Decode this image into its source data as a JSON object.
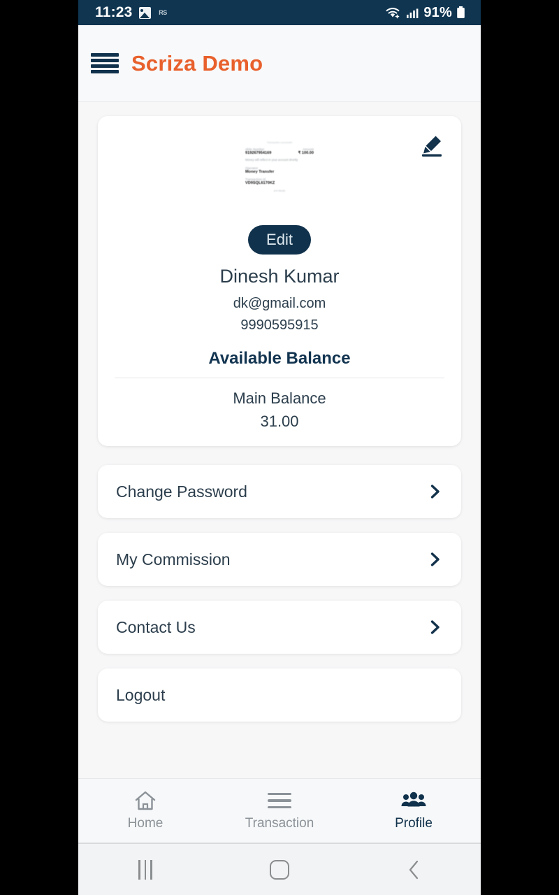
{
  "status_bar": {
    "time": "11:23",
    "battery_percent": "91%",
    "icons": [
      "gallery-icon",
      "app-badge-icon",
      "wifi-icon",
      "cellular-signal-icon",
      "battery-icon"
    ]
  },
  "app_bar": {
    "menu_icon": "hamburger-menu-icon",
    "title": "Scriza Demo",
    "brand_color": "#e8602c"
  },
  "profile": {
    "edit_pencil_icon": "edit-pencil-icon",
    "avatar_alt": "profile-photo-receipt",
    "avatar_receipt": {
      "top_faint": "Transaction successful",
      "mobile_label": "obile Number",
      "mobile_value": "919267954169",
      "amount_label": "Amount",
      "amount_value": "₹ 100.00",
      "note": "Money will reflect in your account shortly",
      "operator_label": "Operator",
      "operator_value": "Money Transfer",
      "txn_label": "Transaction Id",
      "txn_value": "VD9SQL6170KZ",
      "bottom_faint": "ent Mode"
    },
    "edit_button": "Edit",
    "name": "Dinesh Kumar",
    "email": "dk@gmail.com",
    "phone": "9990595915",
    "balance_heading": "Available Balance",
    "balance_label": "Main Balance",
    "balance_value": "31.00"
  },
  "menu": {
    "items": [
      {
        "label": "Change Password",
        "chevron": true,
        "icon": "chevron-right-icon"
      },
      {
        "label": "My Commission",
        "chevron": true,
        "icon": "chevron-right-icon"
      },
      {
        "label": "Contact Us",
        "chevron": true,
        "icon": "chevron-right-icon"
      },
      {
        "label": "Logout",
        "chevron": false,
        "icon": ""
      }
    ]
  },
  "bottom_nav": {
    "items": [
      {
        "label": "Home",
        "icon": "home-icon",
        "active": false
      },
      {
        "label": "Transaction",
        "icon": "list-lines-icon",
        "active": false
      },
      {
        "label": "Profile",
        "icon": "people-group-icon",
        "active": true
      }
    ],
    "active_color": "#11324c",
    "inactive_color": "#8b9298"
  },
  "android_nav": {
    "recents_icon": "recents-icon",
    "home_icon": "home-square-icon",
    "back_icon": "back-chevron-icon"
  }
}
